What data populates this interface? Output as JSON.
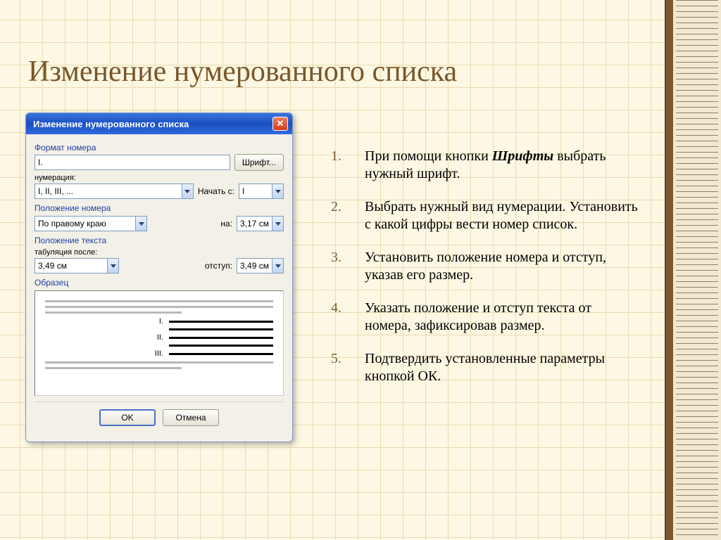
{
  "page": {
    "title": "Изменение нумерованного списка"
  },
  "dialog": {
    "title": "Изменение нумерованного списка",
    "close_symbol": "✕",
    "group_format": "Формат номера",
    "format_value": "I.",
    "font_btn": "Шрифт...",
    "numbering_label": "нумерация:",
    "numbering_value": "I, II, III, ...",
    "start_label": "Начать с:",
    "start_value": "I",
    "group_position": "Положение номера",
    "align_value": "По правому краю",
    "at_label": "на:",
    "at_value": "3,17 см",
    "group_textpos": "Положение текста",
    "tab_label": "табуляция после:",
    "tab_value": "3,49 см",
    "indent_label": "отступ:",
    "indent_value": "3,49 см",
    "group_sample": "Образец",
    "ok": "OK",
    "cancel": "Отмена",
    "preview_nums": [
      "I.",
      "II.",
      "III."
    ]
  },
  "list": {
    "items": [
      {
        "n": "1.",
        "text_pre": "При помощи кнопки ",
        "bold": "Шрифты",
        "text_post": " выбрать нужный шрифт."
      },
      {
        "n": "2.",
        "text_pre": "Выбрать нужный вид нумерации. Установить с какой цифры вести номер список.",
        "bold": "",
        "text_post": ""
      },
      {
        "n": "3.",
        "text_pre": "Установить положение номера и отступ, указав его размер.",
        "bold": "",
        "text_post": ""
      },
      {
        "n": "4.",
        "text_pre": "Указать положение и отступ текста от номера, зафиксировав размер.",
        "bold": "",
        "text_post": ""
      },
      {
        "n": "5.",
        "text_pre": "Подтвердить установленные параметры кнопкой ОК.",
        "bold": "",
        "text_post": ""
      }
    ]
  }
}
